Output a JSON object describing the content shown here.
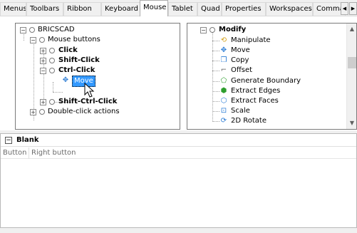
{
  "tabs": [
    {
      "label": "Menus",
      "active": false
    },
    {
      "label": "Toolbars",
      "active": false
    },
    {
      "label": "Ribbon",
      "active": false
    },
    {
      "label": "Keyboard",
      "active": false
    },
    {
      "label": "Mouse",
      "active": true
    },
    {
      "label": "Tablet",
      "active": false
    },
    {
      "label": "Quad",
      "active": false
    },
    {
      "label": "Properties",
      "active": false
    },
    {
      "label": "Workspaces",
      "active": false
    },
    {
      "label": "Comman",
      "active": false
    }
  ],
  "tab_scroll": {
    "left_icon": "chevron-left-icon",
    "left_glyph": "◀",
    "right_icon": "chevron-right-icon",
    "right_glyph": "▶"
  },
  "left_tree": {
    "root": "BRICSCAD",
    "mouse_buttons": "Mouse buttons",
    "click": "Click",
    "shift_click": "Shift-Click",
    "ctrl_click": "Ctrl-Click",
    "move": "Move",
    "shift_ctrl_click": "Shift-Ctrl-Click",
    "double_click_actions": "Double-click actions"
  },
  "right_tree": {
    "group": "Modify",
    "items": [
      {
        "label": "Manipulate",
        "icon": "manipulate-icon",
        "glyph": "⟲",
        "color": "#d4a017"
      },
      {
        "label": "Move",
        "icon": "move-icon",
        "glyph": "✥",
        "color": "#2a7bd4"
      },
      {
        "label": "Copy",
        "icon": "copy-icon",
        "glyph": "❐",
        "color": "#2a7bd4"
      },
      {
        "label": "Offset",
        "icon": "offset-icon",
        "glyph": "⌐",
        "color": "#555555"
      },
      {
        "label": "Generate Boundary",
        "icon": "boundary-icon",
        "glyph": "⬠",
        "color": "#2e9e2e"
      },
      {
        "label": "Extract Edges",
        "icon": "extract-edges-icon",
        "glyph": "⬢",
        "color": "#2e9e2e"
      },
      {
        "label": "Extract Faces",
        "icon": "extract-faces-icon",
        "glyph": "⬡",
        "color": "#2a7bd4"
      },
      {
        "label": "Scale",
        "icon": "scale-icon",
        "glyph": "⊡",
        "color": "#2a7bd4"
      },
      {
        "label": "2D Rotate",
        "icon": "rotate-icon",
        "glyph": "⟳",
        "color": "#2a7bd4"
      }
    ]
  },
  "lower": {
    "group_title": "Blank",
    "expander": "⊟",
    "row": {
      "button": "Button",
      "value": "Right button"
    }
  },
  "colors": {
    "selection": "#3399ff"
  }
}
